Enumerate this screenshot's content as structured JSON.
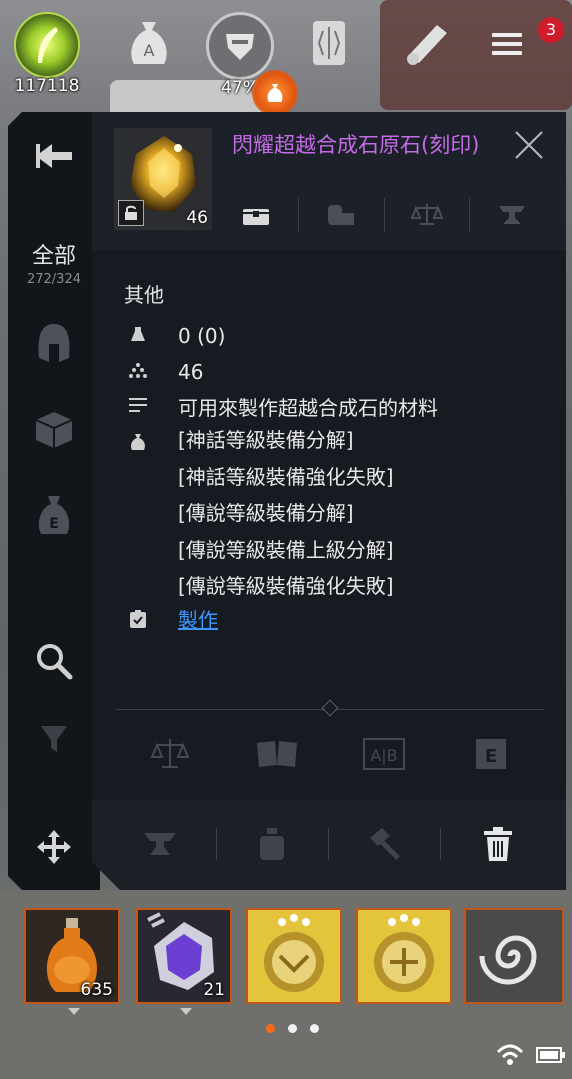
{
  "hud": {
    "energy_value": "117118",
    "gauge_percent": "47%",
    "notification_count": "3",
    "icons": [
      "energy-feather-icon",
      "money-bag-a-icon",
      "armor-gauge-icon",
      "scroll-icon",
      "map-scroll-icon",
      "menu-icon"
    ]
  },
  "sidebar": {
    "category_title": "全部",
    "capacity": "272/324",
    "icons": [
      "back-arrow-icon",
      "helmet-icon",
      "box-icon",
      "money-bag-e-icon",
      "search-icon",
      "filter-icon",
      "move-icon"
    ]
  },
  "item": {
    "name": "閃耀超越合成石原石(刻印)",
    "stack_count": "46",
    "name_color": "#c46be6",
    "tabs": [
      "chest-icon",
      "mailbox-icon",
      "scale-icon",
      "anvil-icon"
    ]
  },
  "details": {
    "category": "其他",
    "weight": "0 (0)",
    "quantity": "46",
    "description": "可用來製作超越合成石的材料",
    "sources": [
      "[神話等級裝備分解]",
      "[神話等級裝備強化失敗]",
      "[傳說等級裝備分解]",
      "[傳說等級裝備上級分解]",
      "[傳說等級裝備強化失敗]"
    ],
    "craft_link": "製作",
    "link_color": "#3d95ff"
  },
  "compare_icons": [
    "scale-icon",
    "book-icon",
    "ab-compare-icon",
    "e-icon"
  ],
  "action_icons": [
    "anvil-icon",
    "potion-icon",
    "hammer-icon",
    "trash-icon"
  ],
  "quick_slots": [
    {
      "name": "orange-potion",
      "count": "635"
    },
    {
      "name": "purple-crystal",
      "count": "21"
    },
    {
      "name": "gold-emblem-a",
      "count": ""
    },
    {
      "name": "gold-emblem-b",
      "count": ""
    },
    {
      "name": "vortex-skill",
      "count": ""
    }
  ],
  "page_dots": {
    "total": 3,
    "active": 0
  },
  "accent_color": "#ff6a1a"
}
